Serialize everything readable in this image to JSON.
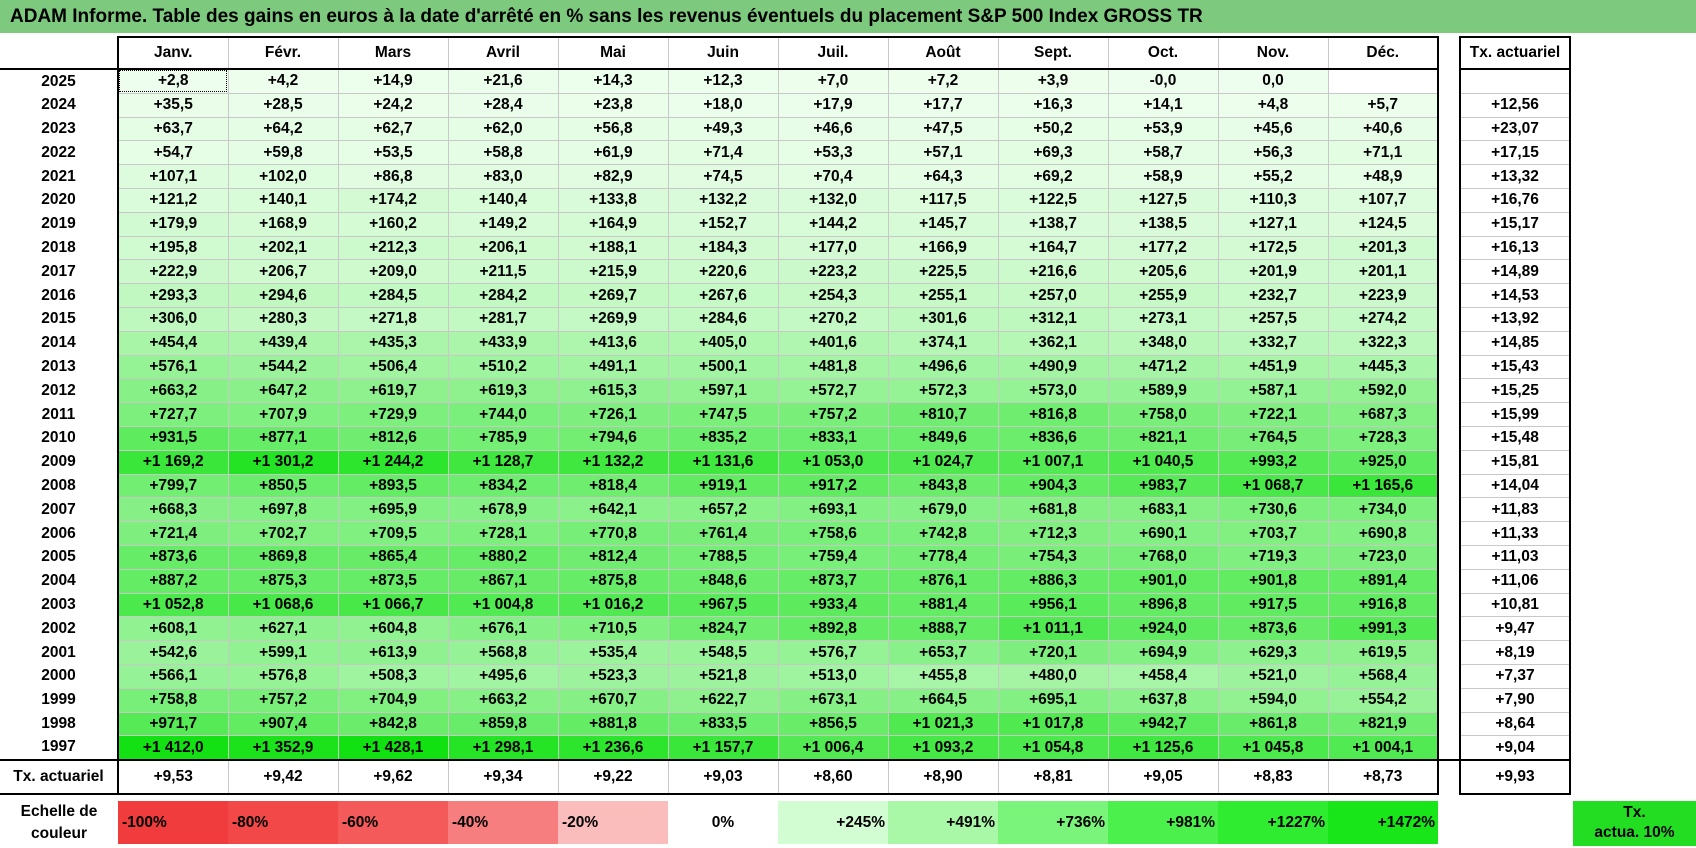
{
  "title": "ADAM Informe. Table des gains en euros à la date d'arrêté en % sans les revenus éventuels du placement S&P 500 Index GROSS TR",
  "months": [
    "Janv.",
    "Févr.",
    "Mars",
    "Avril",
    "Mai",
    "Juin",
    "Juil.",
    "Août",
    "Sept.",
    "Oct.",
    "Nov.",
    "Déc."
  ],
  "tx_header": "Tx. actuariel",
  "rows": [
    {
      "year": "2025",
      "values": [
        "+2,8",
        "+4,2",
        "+14,9",
        "+21,6",
        "+14,3",
        "+12,3",
        "+7,0",
        "+7,2",
        "+3,9",
        "-0,0",
        "0,0",
        ""
      ],
      "tx": ""
    },
    {
      "year": "2024",
      "values": [
        "+35,5",
        "+28,5",
        "+24,2",
        "+28,4",
        "+23,8",
        "+18,0",
        "+17,9",
        "+17,7",
        "+16,3",
        "+14,1",
        "+4,8",
        "+5,7"
      ],
      "tx": "+12,56"
    },
    {
      "year": "2023",
      "values": [
        "+63,7",
        "+64,2",
        "+62,7",
        "+62,0",
        "+56,8",
        "+49,3",
        "+46,6",
        "+47,5",
        "+50,2",
        "+53,9",
        "+45,6",
        "+40,6"
      ],
      "tx": "+23,07"
    },
    {
      "year": "2022",
      "values": [
        "+54,7",
        "+59,8",
        "+53,5",
        "+58,8",
        "+61,9",
        "+71,4",
        "+53,3",
        "+57,1",
        "+69,3",
        "+58,7",
        "+56,3",
        "+71,1"
      ],
      "tx": "+17,15"
    },
    {
      "year": "2021",
      "values": [
        "+107,1",
        "+102,0",
        "+86,8",
        "+83,0",
        "+82,9",
        "+74,5",
        "+70,4",
        "+64,3",
        "+69,2",
        "+58,9",
        "+55,2",
        "+48,9"
      ],
      "tx": "+13,32"
    },
    {
      "year": "2020",
      "values": [
        "+121,2",
        "+140,1",
        "+174,2",
        "+140,4",
        "+133,8",
        "+132,2",
        "+132,0",
        "+117,5",
        "+122,5",
        "+127,5",
        "+110,3",
        "+107,7"
      ],
      "tx": "+16,76"
    },
    {
      "year": "2019",
      "values": [
        "+179,9",
        "+168,9",
        "+160,2",
        "+149,2",
        "+164,9",
        "+152,7",
        "+144,2",
        "+145,7",
        "+138,7",
        "+138,5",
        "+127,1",
        "+124,5"
      ],
      "tx": "+15,17"
    },
    {
      "year": "2018",
      "values": [
        "+195,8",
        "+202,1",
        "+212,3",
        "+206,1",
        "+188,1",
        "+184,3",
        "+177,0",
        "+166,9",
        "+164,7",
        "+177,2",
        "+172,5",
        "+201,3"
      ],
      "tx": "+16,13"
    },
    {
      "year": "2017",
      "values": [
        "+222,9",
        "+206,7",
        "+209,0",
        "+211,5",
        "+215,9",
        "+220,6",
        "+223,2",
        "+225,5",
        "+216,6",
        "+205,6",
        "+201,9",
        "+201,1"
      ],
      "tx": "+14,89"
    },
    {
      "year": "2016",
      "values": [
        "+293,3",
        "+294,6",
        "+284,5",
        "+284,2",
        "+269,7",
        "+267,6",
        "+254,3",
        "+255,1",
        "+257,0",
        "+255,9",
        "+232,7",
        "+223,9"
      ],
      "tx": "+14,53"
    },
    {
      "year": "2015",
      "values": [
        "+306,0",
        "+280,3",
        "+271,8",
        "+281,7",
        "+269,9",
        "+284,6",
        "+270,2",
        "+301,6",
        "+312,1",
        "+273,1",
        "+257,5",
        "+274,2"
      ],
      "tx": "+13,92"
    },
    {
      "year": "2014",
      "values": [
        "+454,4",
        "+439,4",
        "+435,3",
        "+433,9",
        "+413,6",
        "+405,0",
        "+401,6",
        "+374,1",
        "+362,1",
        "+348,0",
        "+332,7",
        "+322,3"
      ],
      "tx": "+14,85"
    },
    {
      "year": "2013",
      "values": [
        "+576,1",
        "+544,2",
        "+506,4",
        "+510,2",
        "+491,1",
        "+500,1",
        "+481,8",
        "+496,6",
        "+490,9",
        "+471,2",
        "+451,9",
        "+445,3"
      ],
      "tx": "+15,43"
    },
    {
      "year": "2012",
      "values": [
        "+663,2",
        "+647,2",
        "+619,7",
        "+619,3",
        "+615,3",
        "+597,1",
        "+572,7",
        "+572,3",
        "+573,0",
        "+589,9",
        "+587,1",
        "+592,0"
      ],
      "tx": "+15,25"
    },
    {
      "year": "2011",
      "values": [
        "+727,7",
        "+707,9",
        "+729,9",
        "+744,0",
        "+726,1",
        "+747,5",
        "+757,2",
        "+810,7",
        "+816,8",
        "+758,0",
        "+722,1",
        "+687,3"
      ],
      "tx": "+15,99"
    },
    {
      "year": "2010",
      "values": [
        "+931,5",
        "+877,1",
        "+812,6",
        "+785,9",
        "+794,6",
        "+835,2",
        "+833,1",
        "+849,6",
        "+836,6",
        "+821,1",
        "+764,5",
        "+728,3"
      ],
      "tx": "+15,48"
    },
    {
      "year": "2009",
      "values": [
        "+1 169,2",
        "+1 301,2",
        "+1 244,2",
        "+1 128,7",
        "+1 132,2",
        "+1 131,6",
        "+1 053,0",
        "+1 024,7",
        "+1 007,1",
        "+1 040,5",
        "+993,2",
        "+925,0"
      ],
      "tx": "+15,81"
    },
    {
      "year": "2008",
      "values": [
        "+799,7",
        "+850,5",
        "+893,5",
        "+834,2",
        "+818,4",
        "+919,1",
        "+917,2",
        "+843,8",
        "+904,3",
        "+983,7",
        "+1 068,7",
        "+1 165,6"
      ],
      "tx": "+14,04"
    },
    {
      "year": "2007",
      "values": [
        "+668,3",
        "+697,8",
        "+695,9",
        "+678,9",
        "+642,1",
        "+657,2",
        "+693,1",
        "+679,0",
        "+681,8",
        "+683,1",
        "+730,6",
        "+734,0"
      ],
      "tx": "+11,83"
    },
    {
      "year": "2006",
      "values": [
        "+721,4",
        "+702,7",
        "+709,5",
        "+728,1",
        "+770,8",
        "+761,4",
        "+758,6",
        "+742,8",
        "+712,3",
        "+690,1",
        "+703,7",
        "+690,8"
      ],
      "tx": "+11,33"
    },
    {
      "year": "2005",
      "values": [
        "+873,6",
        "+869,8",
        "+865,4",
        "+880,2",
        "+812,4",
        "+788,5",
        "+759,4",
        "+778,4",
        "+754,3",
        "+768,0",
        "+719,3",
        "+723,0"
      ],
      "tx": "+11,03"
    },
    {
      "year": "2004",
      "values": [
        "+887,2",
        "+875,3",
        "+873,5",
        "+867,1",
        "+875,8",
        "+848,6",
        "+873,7",
        "+876,1",
        "+886,3",
        "+901,0",
        "+901,8",
        "+891,4"
      ],
      "tx": "+11,06"
    },
    {
      "year": "2003",
      "values": [
        "+1 052,8",
        "+1 068,6",
        "+1 066,7",
        "+1 004,8",
        "+1 016,2",
        "+967,5",
        "+933,4",
        "+881,4",
        "+956,1",
        "+896,8",
        "+917,5",
        "+916,8"
      ],
      "tx": "+10,81"
    },
    {
      "year": "2002",
      "values": [
        "+608,1",
        "+627,1",
        "+604,8",
        "+676,1",
        "+710,5",
        "+824,7",
        "+892,8",
        "+888,7",
        "+1 011,1",
        "+924,0",
        "+873,6",
        "+991,3"
      ],
      "tx": "+9,47"
    },
    {
      "year": "2001",
      "values": [
        "+542,6",
        "+599,1",
        "+613,9",
        "+568,8",
        "+535,4",
        "+548,5",
        "+576,7",
        "+653,7",
        "+720,1",
        "+694,9",
        "+629,3",
        "+619,5"
      ],
      "tx": "+8,19"
    },
    {
      "year": "2000",
      "values": [
        "+566,1",
        "+576,8",
        "+508,3",
        "+495,6",
        "+523,3",
        "+521,8",
        "+513,0",
        "+455,8",
        "+480,0",
        "+458,4",
        "+521,0",
        "+568,4"
      ],
      "tx": "+7,37"
    },
    {
      "year": "1999",
      "values": [
        "+758,8",
        "+757,2",
        "+704,9",
        "+663,2",
        "+670,7",
        "+622,7",
        "+673,1",
        "+664,5",
        "+695,1",
        "+637,8",
        "+594,0",
        "+554,2"
      ],
      "tx": "+7,90"
    },
    {
      "year": "1998",
      "values": [
        "+971,7",
        "+907,4",
        "+842,8",
        "+859,8",
        "+881,8",
        "+833,5",
        "+856,5",
        "+1 021,3",
        "+1 017,8",
        "+942,7",
        "+861,8",
        "+821,9"
      ],
      "tx": "+8,64"
    },
    {
      "year": "1997",
      "values": [
        "+1 412,0",
        "+1 352,9",
        "+1 428,1",
        "+1 298,1",
        "+1 236,6",
        "+1 157,7",
        "+1 006,4",
        "+1 093,2",
        "+1 054,8",
        "+1 125,6",
        "+1 045,8",
        "+1 004,1"
      ],
      "tx": "+9,04"
    }
  ],
  "footer": {
    "label": "Tx. actuariel",
    "values": [
      "+9,53",
      "+9,42",
      "+9,62",
      "+9,34",
      "+9,22",
      "+9,03",
      "+8,60",
      "+8,90",
      "+8,81",
      "+9,05",
      "+8,83",
      "+8,73"
    ],
    "tx": "+9,93"
  },
  "legend": {
    "label_line1": "Echelle de",
    "label_line2": "couleur",
    "swatches": [
      {
        "label": "-100%",
        "color": "#f03c3c",
        "kind": "neg"
      },
      {
        "label": "-80%",
        "color": "#f24848",
        "kind": "neg"
      },
      {
        "label": "-60%",
        "color": "#f45a5a",
        "kind": "neg"
      },
      {
        "label": "-40%",
        "color": "#f67e7e",
        "kind": "neg"
      },
      {
        "label": "-20%",
        "color": "#fbbcbc",
        "kind": "neg"
      },
      {
        "label": "0%",
        "color": "#ffffff",
        "kind": "zero"
      },
      {
        "label": "+245%",
        "color": "#d2fcd2",
        "kind": "pos"
      },
      {
        "label": "+491%",
        "color": "#a8f8a8",
        "kind": "pos"
      },
      {
        "label": "+736%",
        "color": "#7af47a",
        "kind": "pos"
      },
      {
        "label": "+981%",
        "color": "#4cf04c",
        "kind": "pos"
      },
      {
        "label": "+1227%",
        "color": "#30ec30",
        "kind": "pos"
      },
      {
        "label": "+1472%",
        "color": "#18e618",
        "kind": "pos"
      }
    ],
    "tx_line1": "Tx.",
    "tx_line2": "actua. 10%",
    "tx_color": "#22dd22"
  },
  "colors": {
    "title_bar": "#7dc97d",
    "scale_zero": "#ffffff",
    "scale_max": "#0ae00a",
    "scale_max_value": 1472
  }
}
